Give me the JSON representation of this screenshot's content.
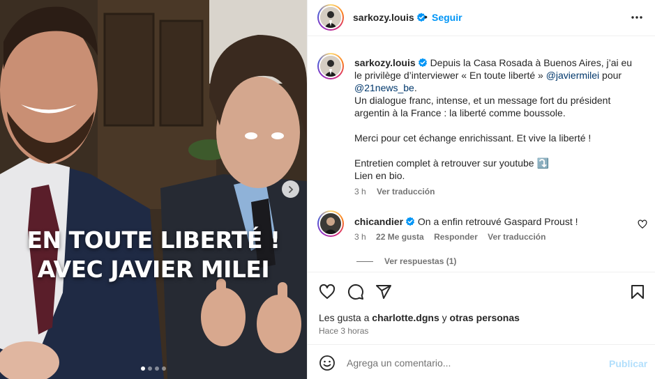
{
  "post": {
    "overlay_line1": "EN TOUTE LIBERTÉ !",
    "overlay_line2": "AVEC JAVIER MILEI",
    "carousel_total": 4,
    "carousel_current": 1
  },
  "header": {
    "username": "sarkozy.louis",
    "separator": "•",
    "follow_label": "Seguir",
    "more_icon": "more-horizontal-icon"
  },
  "caption": {
    "username": "sarkozy.louis",
    "text_1": "Depuis la Casa Rosada à Buenos Aires, j’ai eu le privilège d’interviewer « En toute liberté » ",
    "mention_1": "@javiermilei",
    "text_2": " pour ",
    "mention_2": "@21news_be",
    "text_3": ".",
    "line_dialogue": " Un dialogue franc, intense, et un message fort du président argentin à la France : la liberté comme boussole.",
    "line_thanks": "Merci pour cet échange enrichissant. Et vive la liberté !",
    "line_youtube": "Entretien complet à retrouver sur youtube ⤵️",
    "line_bio": "Lien en bio.",
    "time": "3 h",
    "translate_label": "Ver traducción"
  },
  "comment": {
    "username": "chicandier",
    "text": "On a enfin retrouvé Gaspard Proust !",
    "time": "3 h",
    "likes": "22 Me gusta",
    "reply_label": "Responder",
    "translate_label": "Ver traducción",
    "view_replies": "Ver respuestas (1)"
  },
  "actions": {
    "likes_prefix": "Les gusta a ",
    "likes_user": "charlotte.dgns",
    "likes_mid": " y ",
    "likes_others": "otras personas",
    "time": "Hace 3 horas"
  },
  "add_comment": {
    "placeholder": "Agrega un comentario...",
    "publish_label": "Publicar"
  },
  "colors": {
    "link_blue": "#0095f6",
    "mention_blue": "#00376b",
    "verified_blue": "#0095f6",
    "publish_disabled": "#b2dffc"
  }
}
